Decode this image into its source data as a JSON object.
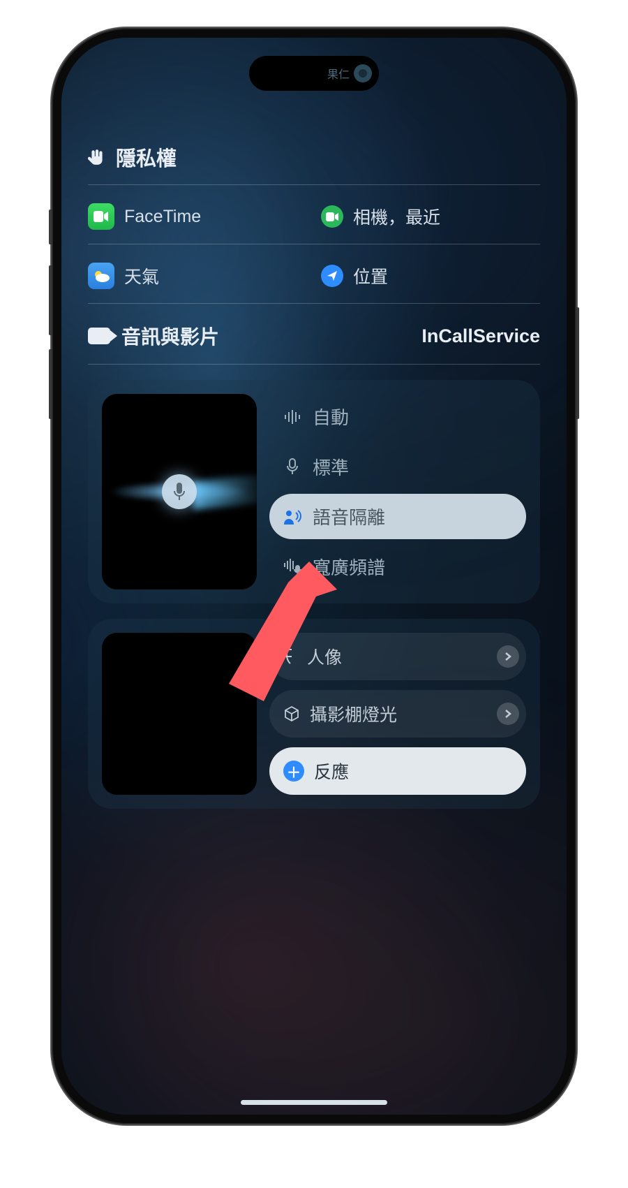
{
  "island": {
    "label": "果仁"
  },
  "privacy": {
    "title": "隱私權",
    "row1": {
      "left": {
        "label": "FaceTime"
      },
      "right": {
        "label": "相機，最近"
      }
    },
    "row2": {
      "left": {
        "label": "天氣"
      },
      "right": {
        "label": "位置"
      }
    }
  },
  "av": {
    "title": "音訊與影片",
    "service": "InCallService"
  },
  "mic_modes": {
    "auto": "自動",
    "standard": "標準",
    "voice_isolation": "語音隔離",
    "wide_spectrum": "寬廣頻譜"
  },
  "video_effects": {
    "portrait": "人像",
    "studio_light": "攝影棚燈光",
    "reactions": "反應"
  }
}
